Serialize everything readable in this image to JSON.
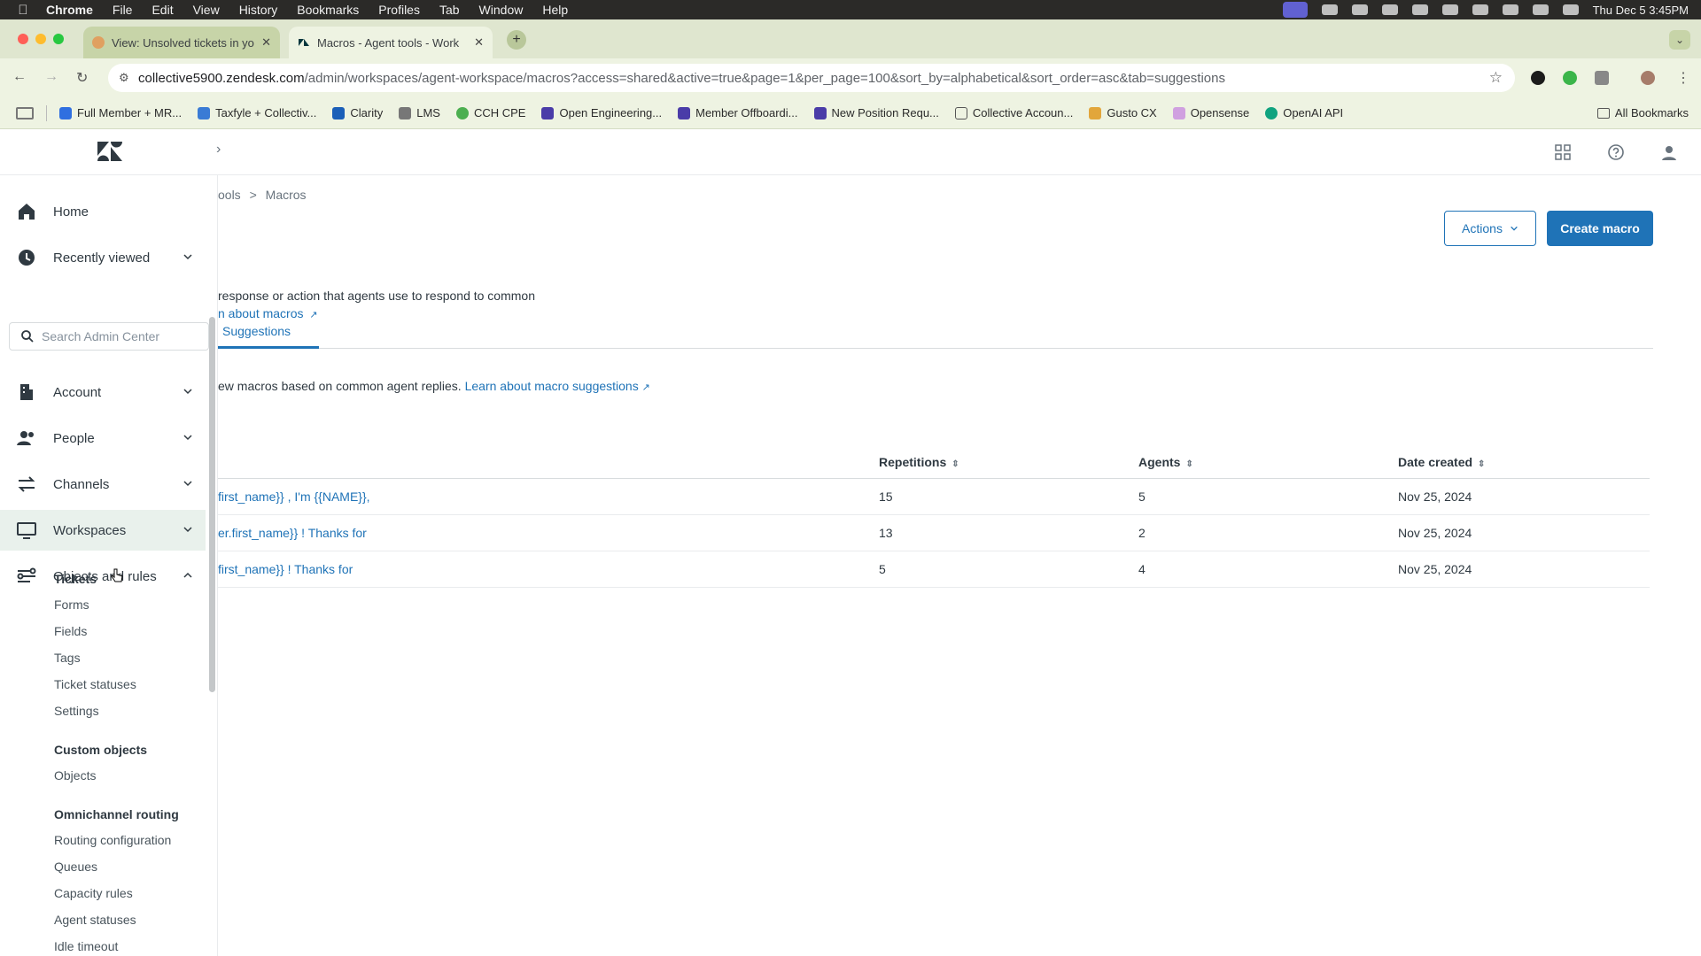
{
  "menubar": {
    "app": "Chrome",
    "items": [
      "File",
      "Edit",
      "View",
      "History",
      "Bookmarks",
      "Profiles",
      "Tab",
      "Window",
      "Help"
    ],
    "datetime": "Thu Dec 5  3:45PM"
  },
  "tabs": [
    {
      "title": "View: Unsolved tickets in you",
      "active": false
    },
    {
      "title": "Macros - Agent tools - Work",
      "active": true
    }
  ],
  "address": {
    "host": "collective5900.zendesk.com",
    "path": "/admin/workspaces/agent-workspace/macros?access=shared&active=true&page=1&per_page=100&sort_by=alphabetical&sort_order=asc&tab=suggestions"
  },
  "bookmarks": [
    "Full Member + MR...",
    "Taxfyle + Collectiv...",
    "Clarity",
    "LMS",
    "CCH CPE",
    "Open Engineering...",
    "Member Offboardi...",
    "New Position Requ...",
    "Collective Accoun...",
    "Gusto CX",
    "Opensense",
    "OpenAI API"
  ],
  "bookmarks_all": "All Bookmarks",
  "sidebar": {
    "home": "Home",
    "recent": "Recently viewed",
    "search_placeholder": "Search Admin Center",
    "account": "Account",
    "people": "People",
    "channels": "Channels",
    "workspaces": "Workspaces",
    "objects": "Objects and rules",
    "tickets_head": "Tickets",
    "tickets": [
      "Forms",
      "Fields",
      "Tags",
      "Ticket statuses",
      "Settings"
    ],
    "custom_head": "Custom objects",
    "custom": [
      "Objects"
    ],
    "omni_head": "Omnichannel routing",
    "omni": [
      "Routing configuration",
      "Queues",
      "Capacity rules",
      "Agent statuses",
      "Idle timeout"
    ]
  },
  "content": {
    "breadcrumb_parent": "ools",
    "breadcrumb_sep": ">",
    "breadcrumb_current": "Macros",
    "desc": "response or action that agents use to respond to common",
    "desc_link": "n about macros",
    "actions_label": "Actions",
    "create_label": "Create macro",
    "tab_suggestions": "Suggestions",
    "info_text": "ew macros based on common agent replies.",
    "info_link": "Learn about macro suggestions",
    "columns": [
      "Repetitions",
      "Agents",
      "Date created"
    ],
    "rows": [
      {
        "title": "first_name}} , I'm {{NAME}},",
        "repetitions": "15",
        "agents": "5",
        "date": "Nov 25, 2024"
      },
      {
        "title": "er.first_name}} ! Thanks for",
        "repetitions": "13",
        "agents": "2",
        "date": "Nov 25, 2024"
      },
      {
        "title": "first_name}} ! Thanks for",
        "repetitions": "5",
        "agents": "4",
        "date": "Nov 25, 2024"
      }
    ]
  },
  "colors": {
    "accent": "#1f73b7",
    "selected_nav": "#e9f1ec",
    "chrome_frame": "#dfe6cf"
  }
}
